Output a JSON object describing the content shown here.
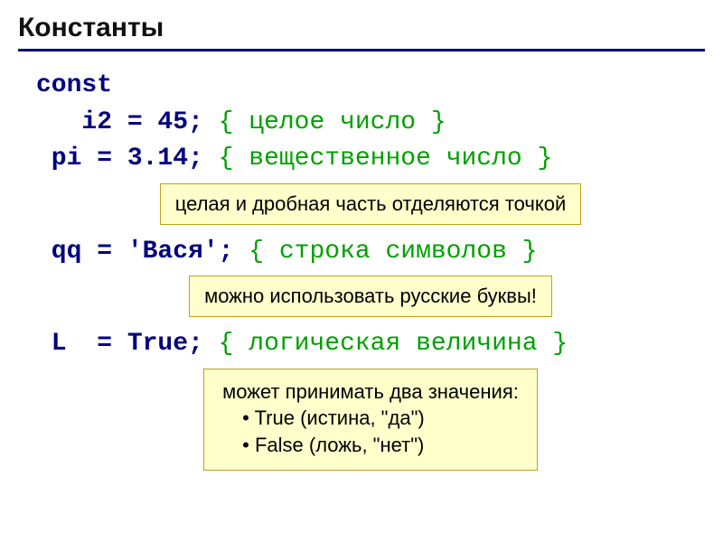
{
  "title": "Константы",
  "code": {
    "keyword_const": "const",
    "line1": {
      "decl": "   i2 = 45;",
      "comment": "{ целое число }"
    },
    "line2": {
      "decl": " pi = 3.14;",
      "comment": "{ вещественное число }"
    },
    "note1": "целая и дробная часть отделяются точкой",
    "line3": {
      "decl": " qq = 'Вася';",
      "comment": "{ строка символов }"
    },
    "note2": "можно использовать русские буквы!",
    "line4": {
      "decl": " L  = True;",
      "comment": "{ логическая величина }"
    },
    "note3": {
      "head": "может принимать два значения:",
      "b1": "True (истина, \"да\")",
      "b2": "False (ложь, \"нет\")"
    }
  }
}
